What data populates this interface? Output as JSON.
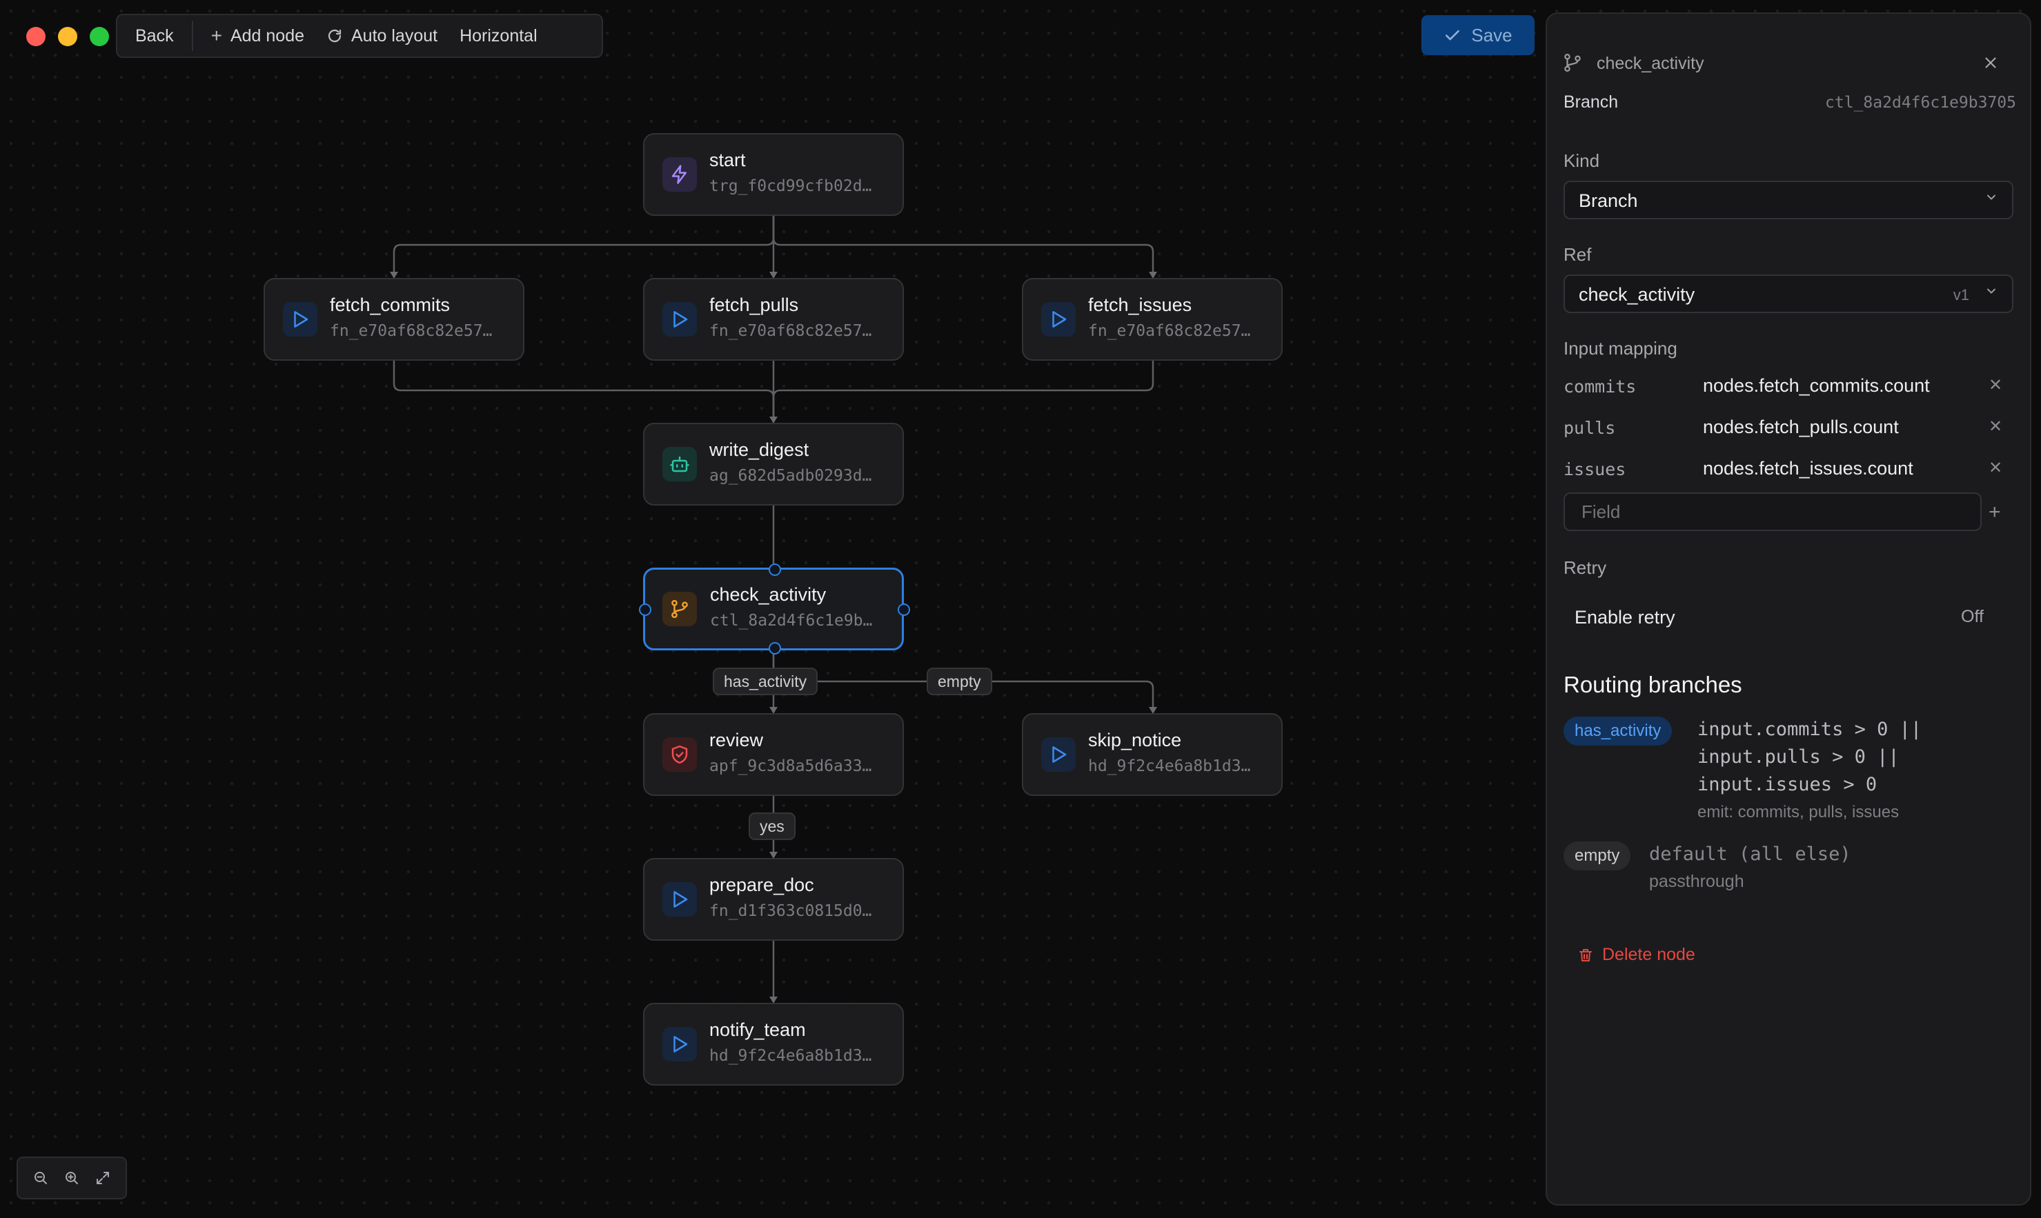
{
  "toolbar": {
    "back_label": "Back",
    "add_node_label": "Add node",
    "auto_layout_label": "Auto layout",
    "orientation_label": "Horizontal",
    "save_label": "Save"
  },
  "colors": {
    "accent": "#2f7fe0",
    "traffic_red": "#ff5f57",
    "traffic_yellow": "#febc2e",
    "traffic_green": "#28c840",
    "delete_red": "#e5483f"
  },
  "nodes": {
    "start": {
      "title": "start",
      "sub": "trg_f0cd99cfb02d…",
      "icon": "lightning-icon"
    },
    "fetch_commits": {
      "title": "fetch_commits",
      "sub": "fn_e70af68c82e57…",
      "icon": "play-icon"
    },
    "fetch_pulls": {
      "title": "fetch_pulls",
      "sub": "fn_e70af68c82e57…",
      "icon": "play-icon"
    },
    "fetch_issues": {
      "title": "fetch_issues",
      "sub": "fn_e70af68c82e57…",
      "icon": "play-icon"
    },
    "write_digest": {
      "title": "write_digest",
      "sub": "ag_682d5adb0293d…",
      "icon": "robot-icon"
    },
    "check_activity": {
      "title": "check_activity",
      "sub": "ctl_8a2d4f6c1e9b…",
      "icon": "branch-icon"
    },
    "review": {
      "title": "review",
      "sub": "apf_9c3d8a5d6a33…",
      "icon": "shield-check-icon"
    },
    "skip_notice": {
      "title": "skip_notice",
      "sub": "hd_9f2c4e6a8b1d3…",
      "icon": "play-icon"
    },
    "prepare_doc": {
      "title": "prepare_doc",
      "sub": "fn_d1f363c0815d0…",
      "icon": "play-icon"
    },
    "notify_team": {
      "title": "notify_team",
      "sub": "hd_9f2c4e6a8b1d3…",
      "icon": "play-icon"
    }
  },
  "edge_labels": {
    "has_activity": "has_activity",
    "empty": "empty",
    "yes": "yes"
  },
  "panel": {
    "node_name": "check_activity",
    "type_label": "Branch",
    "node_id": "ctl_8a2d4f6c1e9b3705",
    "kind_label": "Kind",
    "kind_value": "Branch",
    "ref_label": "Ref",
    "ref_value": "check_activity",
    "ref_version": "v1",
    "input_mapping_label": "Input mapping",
    "mappings": [
      {
        "key": "commits",
        "value": "nodes.fetch_commits.count"
      },
      {
        "key": "pulls",
        "value": "nodes.fetch_pulls.count"
      },
      {
        "key": "issues",
        "value": "nodes.fetch_issues.count"
      }
    ],
    "field_placeholder": "Field",
    "retry_label": "Retry",
    "enable_retry_label": "Enable retry",
    "enable_retry_value": "Off",
    "routing_title": "Routing branches",
    "branches": [
      {
        "name": "has_activity",
        "lines": [
          "input.commits > 0 ||",
          "input.pulls > 0 ||",
          "input.issues > 0"
        ],
        "emit": "emit: commits, pulls, issues"
      },
      {
        "name": "empty",
        "lines": [
          "default (all else)"
        ],
        "emit": "passthrough"
      }
    ],
    "delete_label": "Delete node"
  }
}
